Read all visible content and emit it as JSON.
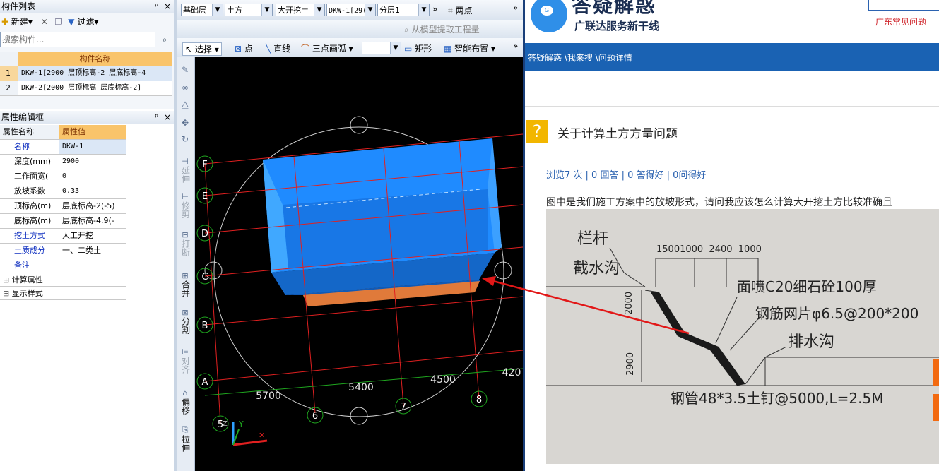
{
  "component_panel": {
    "title": "构件列表",
    "pin": "ᵖ",
    "close": "×",
    "new_label": "新建",
    "filter_label": "过滤",
    "search_placeholder": "搜索构件...",
    "column_header": "构件名称",
    "rows": [
      {
        "num": "1",
        "name": "DKW-1[2900 层顶标高-2 层底标高-4"
      },
      {
        "num": "2",
        "name": "DKW-2[2000 层顶标高 层底标高-2]"
      }
    ]
  },
  "property_panel": {
    "title": "属性编辑框",
    "header_name": "属性名称",
    "header_value": "属性值",
    "rows": [
      {
        "name": "名称",
        "value": "DKW-1",
        "blue": true
      },
      {
        "name": "深度(mm)",
        "value": "2900",
        "blue": false
      },
      {
        "name": "工作面宽(",
        "value": "0",
        "blue": false
      },
      {
        "name": "放坡系数",
        "value": "0.33",
        "blue": false
      },
      {
        "name": "顶标高(m)",
        "value": "层底标高-2(-5)",
        "blue": false
      },
      {
        "name": "底标高(m)",
        "value": "层底标高-4.9(-",
        "blue": false
      },
      {
        "name": "挖土方式",
        "value": "人工开挖",
        "blue": true
      },
      {
        "name": "土质成分",
        "value": "一、二类土",
        "blue": true
      },
      {
        "name": "备注",
        "value": "",
        "blue": true
      }
    ],
    "groups": [
      "计算属性",
      "显示样式"
    ]
  },
  "toolbar1": {
    "combos": [
      "基础层",
      "土方",
      "大开挖土",
      "DKW-1[29(",
      "分层1"
    ],
    "two_point": "两点",
    "extract": "从模型提取工程量"
  },
  "toolbar2": {
    "select": "选择",
    "point": "点",
    "line": "直线",
    "arc": "三点画弧",
    "rect": "矩形",
    "smart": "智能布置"
  },
  "vertical_tools": [
    "延伸",
    "修剪",
    "打断",
    "合并",
    "分割",
    "对齐",
    "偏移",
    "拉伸"
  ],
  "viewport": {
    "axis_letters": [
      "F",
      "E",
      "D",
      "C",
      "B",
      "A"
    ],
    "axis_numbers": [
      "5",
      "6",
      "7",
      "8"
    ],
    "dimensions": [
      "5700",
      "5400",
      "4500",
      "420"
    ],
    "coord_y": "Y",
    "coord_z": "Z"
  },
  "web": {
    "logo_title": "答疑解惑",
    "logo_subtitle": "广联达服务新干线",
    "top_link": "广东常见问题",
    "breadcrumb": "答疑解惑 \\我来搜 \\问题详情",
    "question_title": "关于计算土方方量问题",
    "stats": "浏览7 次 | 0 回答 | 0 答得好 | 0问得好",
    "question_body": "图中是我们施工方案中的放坡形式，请问我应该怎么计算大开挖土方比较准确且",
    "drawing_labels": {
      "railing": "栏杆",
      "intercept": "截水沟",
      "spray": "面喷C20细石砼100厚",
      "mesh": "钢筋网片φ6.5@200*200",
      "drain": "排水沟",
      "pipe": "钢管48*3.5土钉@5000,L=2.5M",
      "dims_top": "15001000  2400  1000",
      "dim_2000": "2000",
      "dim_2900": "2900"
    },
    "colors": {
      "nav_blue": "#1a62b3",
      "question_yellow": "#f2b600",
      "link_blue": "#2b62b0"
    }
  }
}
